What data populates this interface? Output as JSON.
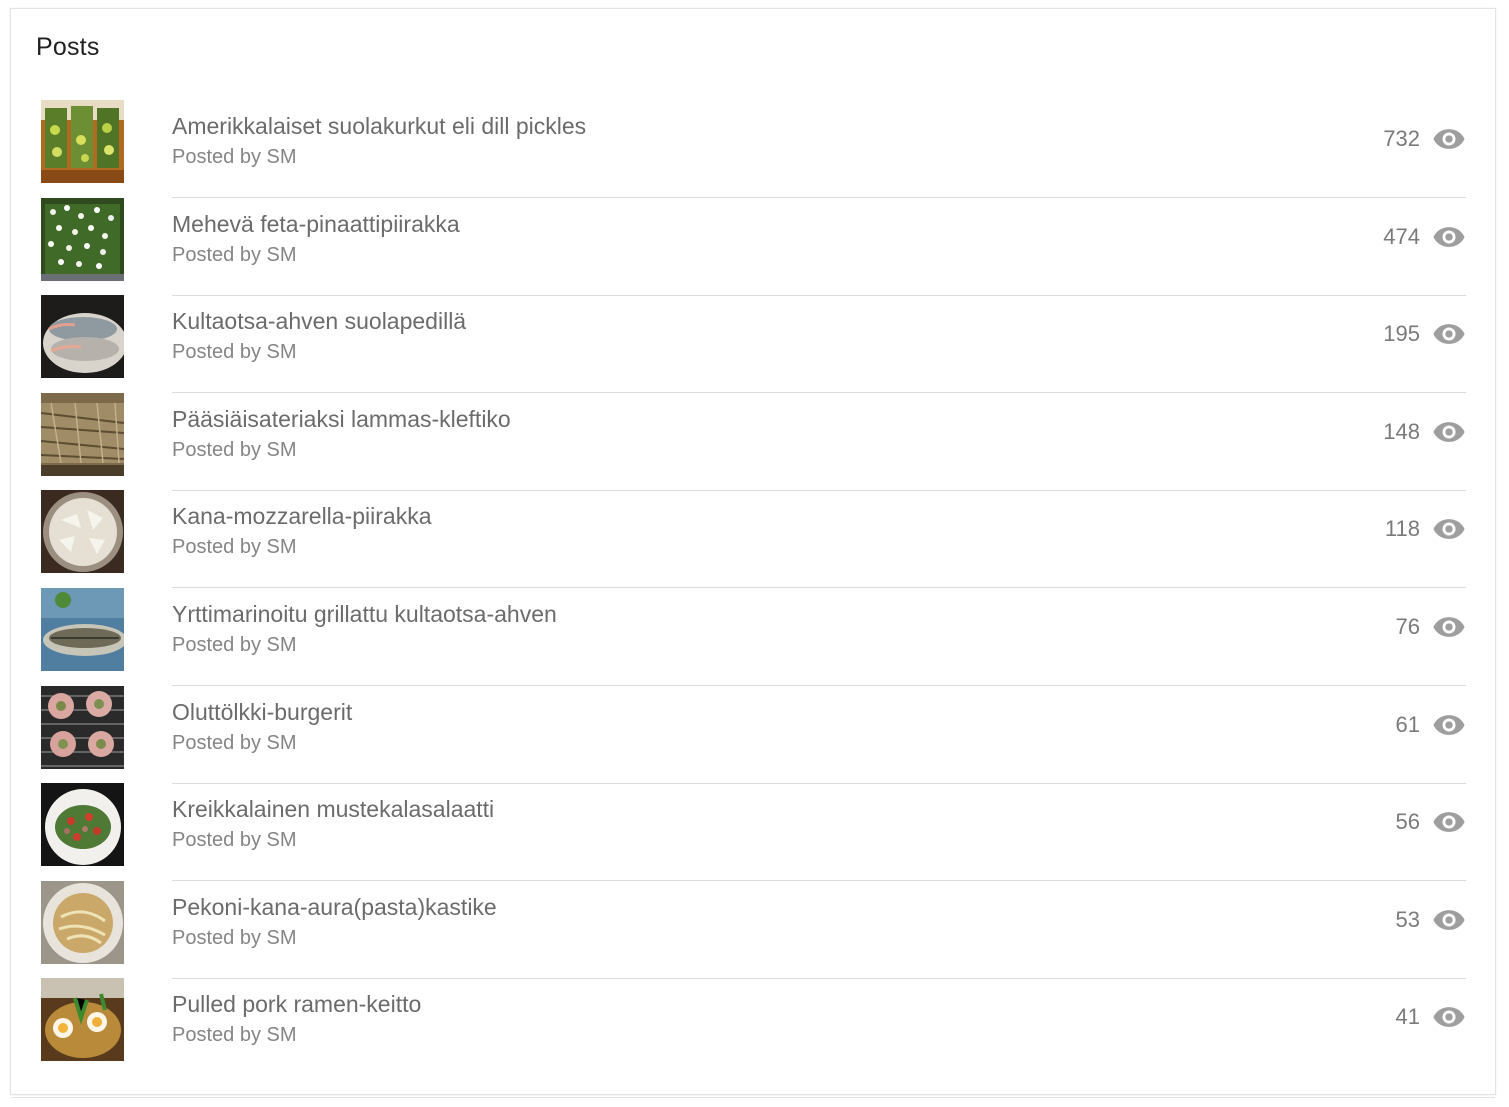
{
  "panel": {
    "title": "Posts"
  },
  "colors": {
    "icon": "#9e9e9e",
    "title_text": "#6b6b6b",
    "meta_text": "#858585",
    "divider": "#dcdcdc"
  },
  "posts": [
    {
      "title": "Amerikkalaiset suolakurkut eli dill pickles",
      "byline": "Posted by SM",
      "views": "732",
      "icon": "eye-icon"
    },
    {
      "title": "Mehevä feta-pinaattipiirakka",
      "byline": "Posted by SM",
      "views": "474",
      "icon": "eye-icon"
    },
    {
      "title": "Kultaotsa-ahven suolapedillä",
      "byline": "Posted by SM",
      "views": "195",
      "icon": "eye-icon"
    },
    {
      "title": "Pääsiäisateriaksi lammas-kleftiko",
      "byline": "Posted by SM",
      "views": "148",
      "icon": "eye-icon"
    },
    {
      "title": "Kana-mozzarella-piirakka",
      "byline": "Posted by SM",
      "views": "118",
      "icon": "eye-icon"
    },
    {
      "title": "Yrttimarinoitu grillattu kultaotsa-ahven",
      "byline": "Posted by SM",
      "views": "76",
      "icon": "eye-icon"
    },
    {
      "title": "Oluttölkki-burgerit",
      "byline": "Posted by SM",
      "views": "61",
      "icon": "eye-icon"
    },
    {
      "title": "Kreikkalainen mustekalasalaatti",
      "byline": "Posted by SM",
      "views": "56",
      "icon": "eye-icon"
    },
    {
      "title": "Pekoni-kana-aura(pasta)kastike",
      "byline": "Posted by SM",
      "views": "53",
      "icon": "eye-icon"
    },
    {
      "title": "Pulled pork ramen-keitto",
      "byline": "Posted by SM",
      "views": "41",
      "icon": "eye-icon"
    }
  ]
}
